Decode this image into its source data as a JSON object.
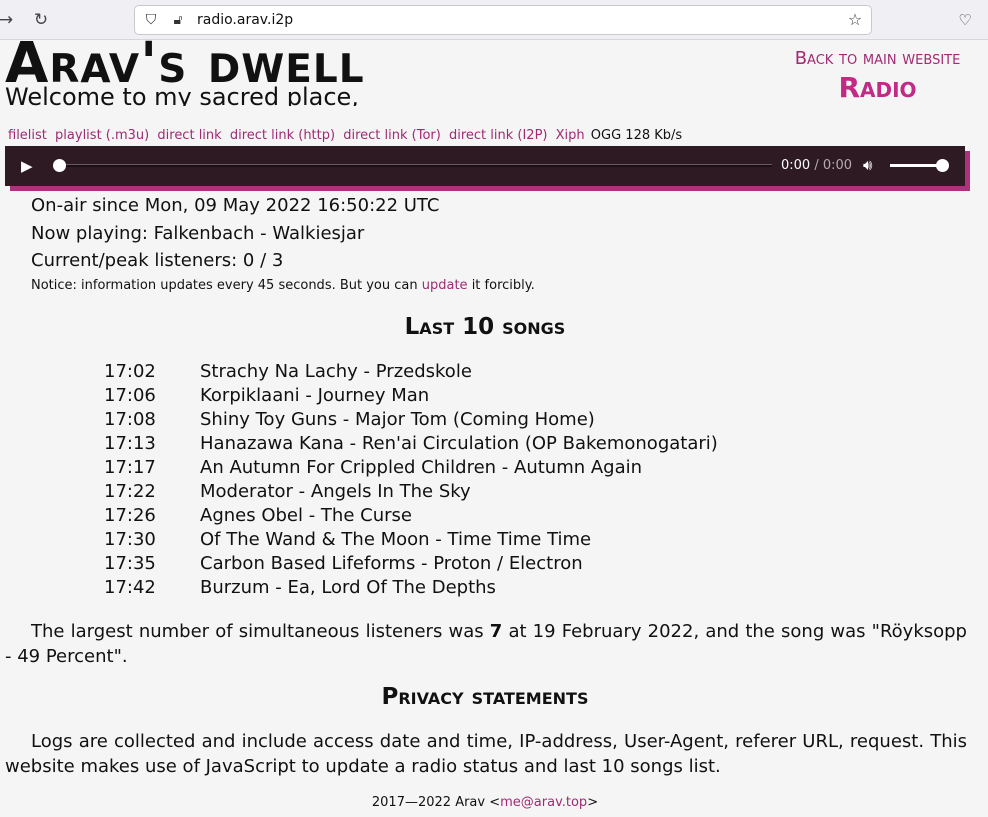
{
  "browser": {
    "url": "radio.arav.i2p",
    "icons": [
      "back-arrow-icon",
      "reload-icon",
      "shield-icon",
      "lock-warning-icon",
      "bookmark-star-icon",
      "pocket-icon"
    ]
  },
  "header": {
    "title": "Arav's dwelling",
    "subtitle": "Welcome to my sacred place, wanderer",
    "back_link": "Back to main website",
    "section_title": "Radio"
  },
  "stream_links": [
    {
      "label": "filelist"
    },
    {
      "label": "playlist (.m3u)"
    },
    {
      "label": "direct link"
    },
    {
      "label": "direct link (http)"
    },
    {
      "label": "direct link (Tor)"
    },
    {
      "label": "direct link (I2P)"
    },
    {
      "label": "Xiph"
    }
  ],
  "stream_format": "OGG 128 Kb/s",
  "player": {
    "current_time": "0:00",
    "separator": " / ",
    "duration": "0:00",
    "progress": 0,
    "volume": 1.0
  },
  "status": {
    "on_air": "On-air since Mon, 09 May 2022 16:50:22 UTC",
    "now_playing": "Now playing: Falkenbach - Walkiesjar",
    "listeners": "Current/peak listeners: 0 / 3",
    "notice_before": "Notice: information updates every 45 seconds. But you can ",
    "notice_link": "update",
    "notice_after": " it forcibly."
  },
  "last_songs": {
    "heading": "Last 10 songs",
    "items": [
      {
        "time": "17:02",
        "song": "Strachy Na Lachy - Przedskole"
      },
      {
        "time": "17:06",
        "song": "Korpiklaani - Journey Man"
      },
      {
        "time": "17:08",
        "song": "Shiny Toy Guns - Major Tom (Coming Home)"
      },
      {
        "time": "17:13",
        "song": "Hanazawa Kana - Ren'ai Circulation (OP Bakemonogatari)"
      },
      {
        "time": "17:17",
        "song": "An Autumn For Crippled Children - Autumn Again"
      },
      {
        "time": "17:22",
        "song": "Moderator - Angels In The Sky"
      },
      {
        "time": "17:26",
        "song": "Agnes Obel - The Curse"
      },
      {
        "time": "17:30",
        "song": "Of The Wand & The Moon - Time Time Time"
      },
      {
        "time": "17:35",
        "song": "Carbon Based Lifeforms - Proton / Electron"
      },
      {
        "time": "17:42",
        "song": "Burzum - Ea, Lord Of The Depths"
      }
    ]
  },
  "record": {
    "text_before": "The largest number of simultaneous listeners was ",
    "count": "7",
    "text_after": " at 19 February 2022, and the song was \"Röyksopp - 49 Percent\"."
  },
  "privacy": {
    "heading": "Privacy statements",
    "text": "Logs are collected and include access date and time, IP-address, User-Agent, referer URL, request. This website makes use of JavaScript to update a radio status and last 10 songs list."
  },
  "footer": {
    "text_before": "2017—2022 Arav <",
    "email": "me@arav.top",
    "text_after": ">"
  },
  "colors": {
    "accent": "#a02b73",
    "title_accent": "#c02b85",
    "player_bg": "#2d1a23",
    "player_shadow": "#b0307e",
    "page_bg": "#f5f5f5"
  }
}
